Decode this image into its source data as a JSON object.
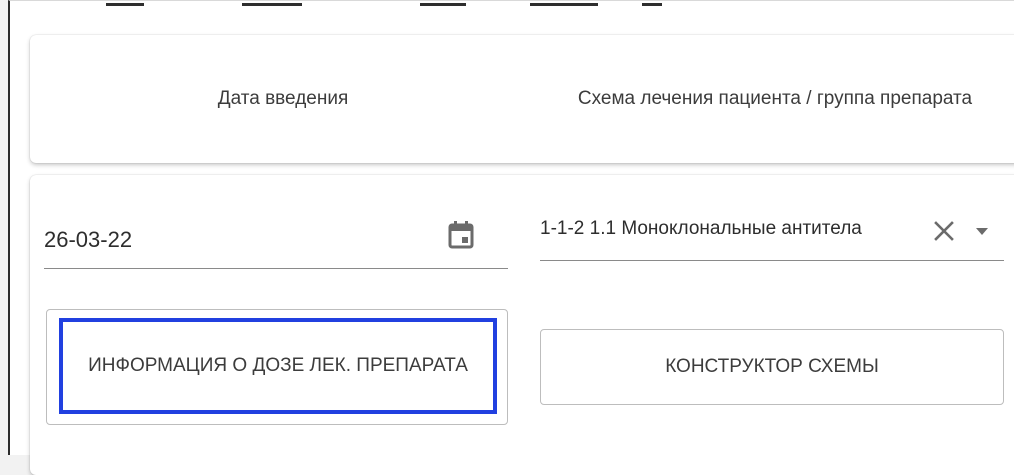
{
  "header": {
    "col1_label": "Дата введения",
    "col2_label": "Схема лечения пациента / группа препарата"
  },
  "row": {
    "date_value": "26-03-22",
    "schema_value": "1-1-2 1.1 Моноклональные антитела"
  },
  "buttons": {
    "dose_info_label": "ИНФОРМАЦИЯ О ДОЗЕ ЛЕК. ПРЕПАРАТА",
    "schema_builder_label": "КОНСТРУКТОР СХЕМЫ"
  },
  "icons": {
    "date": "calendar-icon",
    "clear": "close-icon",
    "dropdown": "caret-down-icon"
  },
  "colors": {
    "focus": "#2140e0",
    "icon": "#6b6b6b",
    "text": "#3c3c3c"
  }
}
